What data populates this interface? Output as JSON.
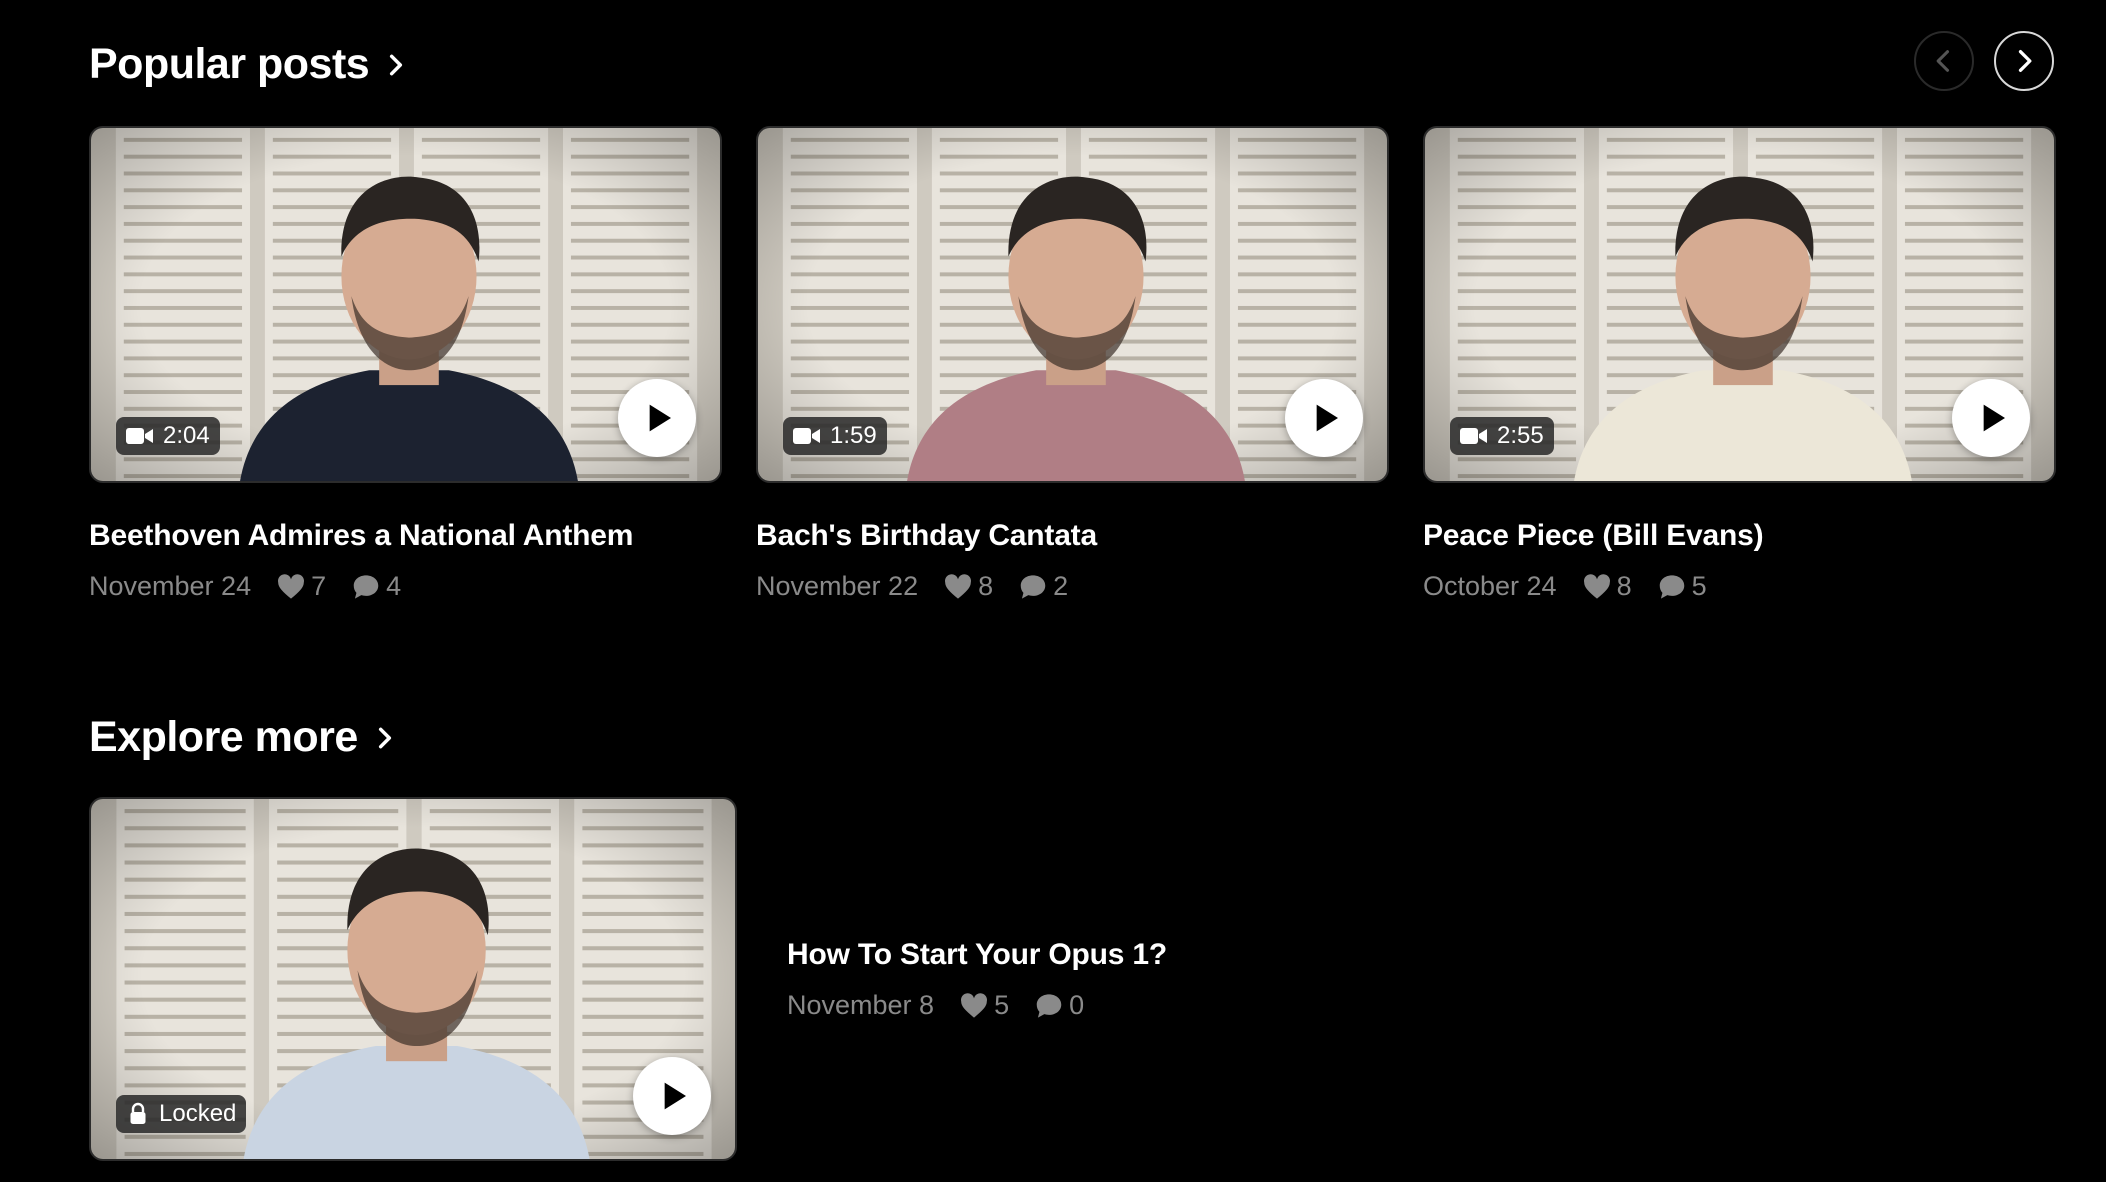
{
  "popular": {
    "title": "Popular posts",
    "posts": [
      {
        "title": "Beethoven Admires a National Anthem",
        "duration": "2:04",
        "date": "November 24",
        "likes": "7",
        "comments": "4",
        "shirt_color": "#1c2230"
      },
      {
        "title": "Bach's Birthday Cantata",
        "duration": "1:59",
        "date": "November 22",
        "likes": "8",
        "comments": "2",
        "shirt_color": "#b07e85"
      },
      {
        "title": "Peace Piece (Bill Evans)",
        "duration": "2:55",
        "date": "October 24",
        "likes": "8",
        "comments": "5",
        "shirt_color": "#ece7d8"
      }
    ]
  },
  "explore": {
    "title": "Explore more",
    "post": {
      "title": "How To Start Your Opus 1?",
      "status": "Locked",
      "date": "November 8",
      "likes": "5",
      "comments": "0",
      "shirt_color": "#c9d4e2"
    }
  },
  "icons": {
    "carousel_prev": "chevron-left-icon",
    "carousel_next": "chevron-right-icon",
    "video": "video-camera-icon",
    "lock": "lock-icon",
    "play": "play-icon",
    "like": "heart-icon",
    "comment": "comment-bubble-icon"
  },
  "colors": {
    "background": "#000000",
    "meta_text": "#8a8a8a",
    "badge_bg": "#282828"
  }
}
